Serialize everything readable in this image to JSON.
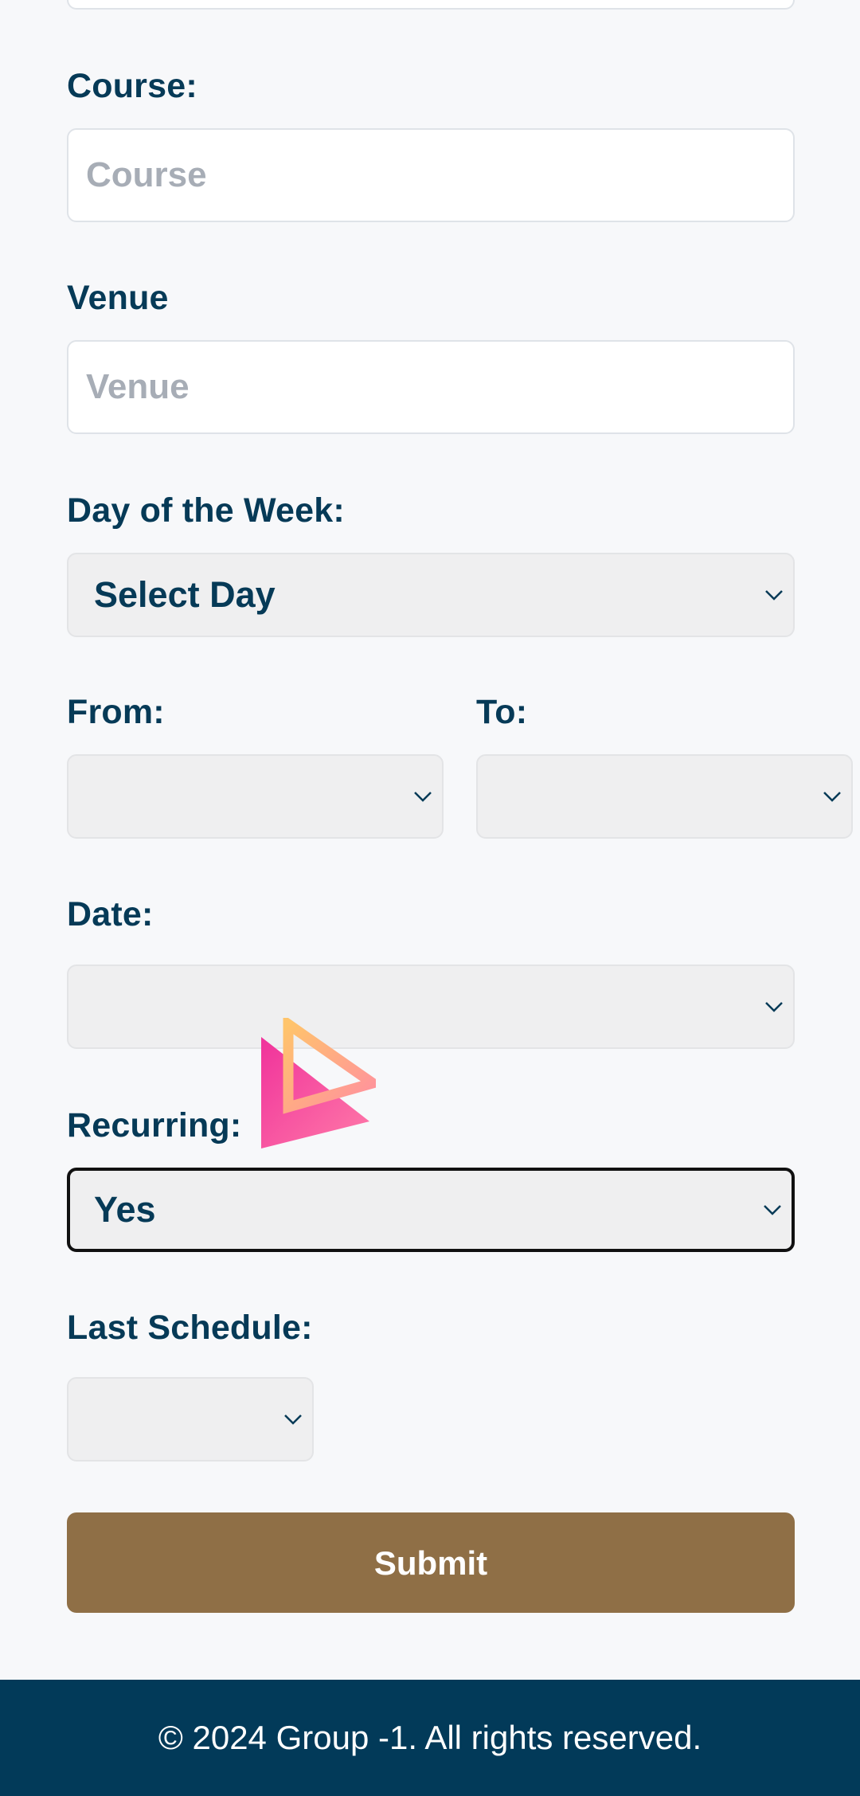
{
  "form": {
    "course": {
      "label": "Course:",
      "placeholder": "Course",
      "value": ""
    },
    "venue": {
      "label": "Venue",
      "placeholder": "Venue",
      "value": ""
    },
    "day_of_week": {
      "label": "Day of the Week:",
      "selected": "Select Day"
    },
    "from": {
      "label": "From:",
      "selected": ""
    },
    "to": {
      "label": "To:",
      "selected": ""
    },
    "date": {
      "label": "Date:",
      "selected": ""
    },
    "recurring": {
      "label": "Recurring:",
      "selected": "Yes"
    },
    "last_schedule": {
      "label": "Last Schedule:",
      "selected": ""
    },
    "submit_label": "Submit"
  },
  "footer": {
    "copyright": "© 2024 Group -1. All rights reserved."
  },
  "icons": {
    "select_chevron": "chevron-down-icon",
    "overlay_logo": "pink-triangle-logo-icon"
  },
  "colors": {
    "label": "#063a57",
    "page_bg": "#f7f8fa",
    "select_bg": "#efeff0",
    "submit_bg": "#8f6f46",
    "footer_bg": "#023a59",
    "logo_pink": "#f0329b",
    "logo_orange": "#ffb36b"
  }
}
